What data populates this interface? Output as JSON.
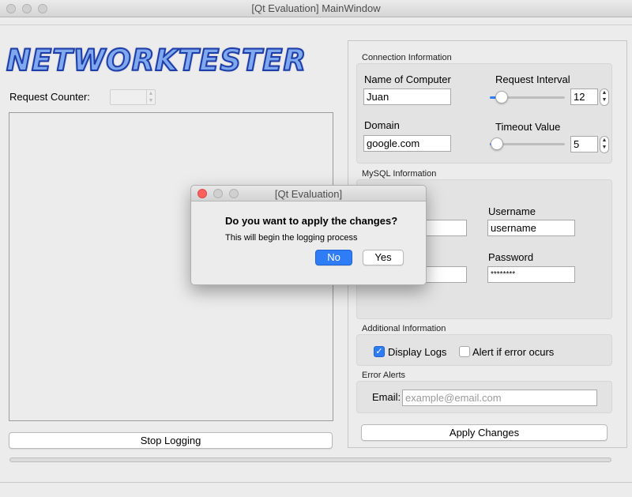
{
  "window": {
    "title": "[Qt Evaluation] MainWindow"
  },
  "logo": {
    "text": "NETWORKTESTER"
  },
  "left": {
    "request_counter_label": "Request Counter:",
    "stop_button": "Stop Logging"
  },
  "connection": {
    "title": "Connection Information",
    "computer_label": "Name of Computer",
    "computer_value": "Juan",
    "domain_label": "Domain",
    "domain_value": "google.com",
    "interval_label": "Request Interval",
    "interval_value": "12",
    "interval_slider_fraction": 0.12,
    "timeout_label": "Timeout Value",
    "timeout_value": "5",
    "timeout_slider_fraction": 0.05
  },
  "mysql": {
    "title": "MySQL Information",
    "username_label": "Username",
    "username_value": "username",
    "password_label": "Password",
    "password_value": "********"
  },
  "additional": {
    "title": "Additional Information",
    "display_logs_label": "Display Logs",
    "display_logs_checked": true,
    "alert_label": "Alert if error ocurs",
    "alert_checked": false
  },
  "error_alerts": {
    "title": "Error Alerts",
    "email_label": "Email:",
    "email_placeholder": "example@email.com"
  },
  "apply_button": "Apply Changes",
  "dialog": {
    "title": "[Qt Evaluation]",
    "heading": "Do you want to apply the changes?",
    "message": "This will begin the logging process",
    "no_label": "No",
    "yes_label": "Yes"
  },
  "colors": {
    "accent": "#2e7cf6",
    "close_red": "#fc605c"
  }
}
